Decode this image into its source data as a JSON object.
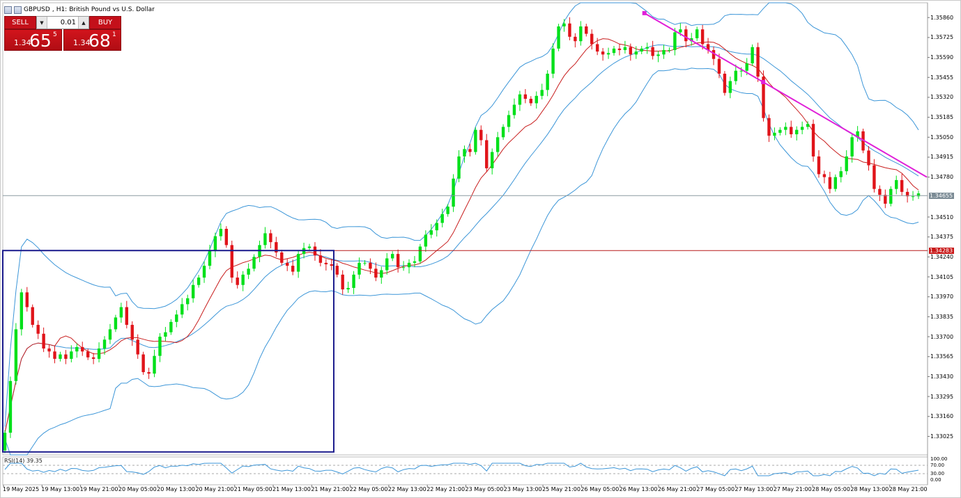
{
  "title": {
    "symbol": "GBPUSD",
    "timeframe": "H1:",
    "description": "British Pound vs U.S. Dollar"
  },
  "trade_panel": {
    "sell_label": "SELL",
    "buy_label": "BUY",
    "lot_value": "0.01",
    "sell_price": {
      "small": "1.34",
      "big": "65",
      "sup": "5"
    },
    "buy_price": {
      "small": "1.34",
      "big": "68",
      "sup": "1"
    },
    "quote_color": "#c4101a"
  },
  "price_axis": {
    "ticks": [
      "1.35860",
      "1.35725",
      "1.35590",
      "1.35455",
      "1.35320",
      "1.35185",
      "1.35050",
      "1.34915",
      "1.34780",
      "1.34510",
      "1.34375",
      "1.34240",
      "1.34105",
      "1.33970",
      "1.33835",
      "1.33700",
      "1.33565",
      "1.33430",
      "1.33295",
      "1.33160",
      "1.33025"
    ],
    "current_price_tag": "1.34655",
    "level_tag": "1.34283"
  },
  "time_axis": {
    "labels": [
      "19 May 2025",
      "19 May 13:00",
      "19 May 21:00",
      "20 May 05:00",
      "20 May 13:00",
      "20 May 21:00",
      "21 May 05:00",
      "21 May 13:00",
      "21 May 21:00",
      "22 May 05:00",
      "22 May 13:00",
      "22 May 21:00",
      "23 May 05:00",
      "23 May 13:00",
      "25 May 21:00",
      "26 May 05:00",
      "26 May 13:00",
      "26 May 21:00",
      "27 May 05:00",
      "27 May 13:00",
      "27 May 21:00",
      "28 May 05:00",
      "28 May 13:00",
      "28 May 21:00"
    ]
  },
  "rsi": {
    "label": "RSI(14) 39.35",
    "ticks": [
      "100.00",
      "70.00",
      "30.00",
      "0.00"
    ]
  },
  "colors": {
    "bull": "#00e01a",
    "bear": "#e0141a",
    "band": "#3c96d8",
    "ma_red": "#c81e1e",
    "trendline": "#e020d8",
    "box": "#1a1a8c",
    "level": "#b81818",
    "price_line": "#8a9aa0",
    "tag_grey": "#7a8a94",
    "tag_red": "#c81818"
  },
  "chart_data": {
    "type": "candlestick",
    "symbol": "GBPUSD",
    "timeframe": "H1",
    "ylim": [
      1.329,
      1.3596
    ],
    "current_price": 1.34655,
    "horizontal_level": 1.34283,
    "trendline": {
      "from": {
        "index": 0.7,
        "price": 1.3589
      },
      "to": {
        "index": 1.0,
        "price": 1.3478
      }
    },
    "box": {
      "price_top": 1.34283,
      "price_bottom": 1.3292,
      "start_fraction": 0.0,
      "end_fraction": 0.36
    },
    "close": [
      1.3305,
      1.334,
      1.3375,
      1.34,
      1.339,
      1.3378,
      1.3372,
      1.3362,
      1.336,
      1.3355,
      1.3358,
      1.3355,
      1.336,
      1.3363,
      1.336,
      1.3356,
      1.3355,
      1.3362,
      1.3368,
      1.3375,
      1.3383,
      1.339,
      1.3378,
      1.3368,
      1.3358,
      1.3346,
      1.3345,
      1.3357,
      1.337,
      1.3373,
      1.338,
      1.3385,
      1.3392,
      1.3396,
      1.3405,
      1.341,
      1.3418,
      1.3428,
      1.3438,
      1.3443,
      1.3432,
      1.341,
      1.3405,
      1.3412,
      1.3416,
      1.3424,
      1.3432,
      1.344,
      1.3434,
      1.3427,
      1.342,
      1.3418,
      1.3414,
      1.3426,
      1.343,
      1.3431,
      1.3425,
      1.342,
      1.3419,
      1.3418,
      1.3412,
      1.3402,
      1.3403,
      1.3412,
      1.342,
      1.342,
      1.3416,
      1.341,
      1.3415,
      1.3423,
      1.3426,
      1.3417,
      1.3417,
      1.342,
      1.3421,
      1.3431,
      1.3439,
      1.3442,
      1.3447,
      1.3453,
      1.3458,
      1.3477,
      1.3492,
      1.3497,
      1.3495,
      1.351,
      1.3503,
      1.3484,
      1.3495,
      1.3505,
      1.3512,
      1.352,
      1.3527,
      1.3534,
      1.3531,
      1.3528,
      1.3533,
      1.3537,
      1.3548,
      1.3565,
      1.358,
      1.3582,
      1.3573,
      1.357,
      1.358,
      1.3575,
      1.3568,
      1.3563,
      1.3561,
      1.3562,
      1.3565,
      1.3564,
      1.3566,
      1.3561,
      1.3563,
      1.3565,
      1.3566,
      1.356,
      1.3561,
      1.3564,
      1.3564,
      1.3576,
      1.3578,
      1.357,
      1.3572,
      1.3578,
      1.3568,
      1.3564,
      1.3558,
      1.3548,
      1.3535,
      1.3543,
      1.355,
      1.355,
      1.3555,
      1.3566,
      1.3546,
      1.3518,
      1.3506,
      1.3508,
      1.351,
      1.3512,
      1.3507,
      1.351,
      1.3512,
      1.3514,
      1.3492,
      1.348,
      1.3478,
      1.347,
      1.3478,
      1.3482,
      1.3492,
      1.3505,
      1.3509,
      1.3496,
      1.3486,
      1.347,
      1.3466,
      1.346,
      1.347,
      1.3476,
      1.3468,
      1.3465,
      1.3465,
      1.3467
    ],
    "upper_band": [
      1.336,
      1.3375,
      1.3388,
      1.3398,
      1.34,
      1.3401,
      1.34,
      1.3395,
      1.3388,
      1.338,
      1.3375,
      1.3382,
      1.3385,
      1.3386,
      1.3389,
      1.3393,
      1.3395,
      1.3398,
      1.3402,
      1.341,
      1.3422,
      1.3438,
      1.3448,
      1.3452,
      1.345,
      1.3445,
      1.344,
      1.3432,
      1.3428,
      1.343,
      1.3433,
      1.3434,
      1.3441,
      1.3446,
      1.3449,
      1.3452,
      1.3453,
      1.3475,
      1.3492,
      1.3502,
      1.3516,
      1.353,
      1.3545,
      1.3562,
      1.3578,
      1.359,
      1.3598,
      1.3598,
      1.3597,
      1.3596,
      1.3592,
      1.3587,
      1.358,
      1.3582,
      1.359,
      1.3597,
      1.3599,
      1.3597,
      1.359,
      1.358,
      1.3572,
      1.356,
      1.3532,
      1.3518,
      1.3515,
      1.3512,
      1.3514,
      1.35
    ]
  }
}
